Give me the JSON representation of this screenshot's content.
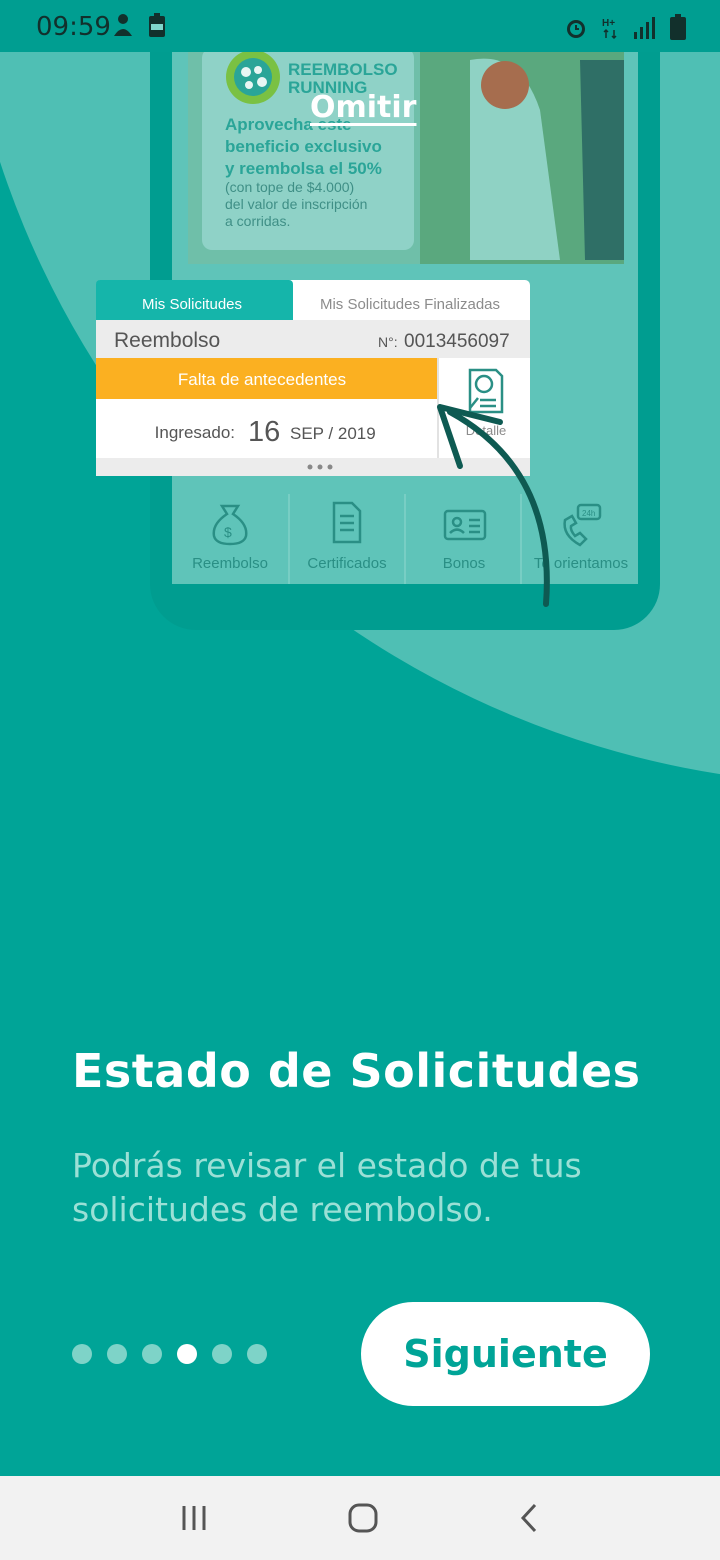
{
  "status_bar": {
    "time": "09:59",
    "icons": [
      "notification-icon",
      "battery-saver-icon",
      "alarm-icon",
      "hplus-network-icon",
      "signal-icon",
      "battery-icon"
    ]
  },
  "skip_label": "Omitir",
  "illustration": {
    "promo": {
      "brand_line1": "REEMBOLSO",
      "brand_line2": "RUNNING",
      "headline1": "Aprovecha este",
      "headline2": "beneficio exclusivo",
      "headline3": "y reembolsa el 50%",
      "body1": "(con tope de $4.000)",
      "body2": "del valor de inscripción",
      "body3": "a corridas."
    },
    "card": {
      "tab_active": "Mis Solicitudes",
      "tab_inactive": "Mis Solicitudes Finalizadas",
      "type": "Reembolso",
      "number_label": "N°:",
      "number": "0013456097",
      "status": "Falta de antecedentes",
      "entered_label": "Ingresado:",
      "day": "16",
      "month_year": "SEP / 2019",
      "detail": "Detalle"
    },
    "nav_items": [
      "Reembolso",
      "Certificados",
      "Bonos",
      "Te orientamos"
    ]
  },
  "title": "Estado de Solicitudes",
  "description": "Podrás revisar el estado de tus solicitudes de reembolso.",
  "pager": {
    "total": 6,
    "active_index": 3
  },
  "next_label": "Siguiente",
  "colors": {
    "background": "#00a497",
    "circle": "#4fbfb4",
    "status_orange": "#fbb021",
    "button_text": "#00a497"
  }
}
